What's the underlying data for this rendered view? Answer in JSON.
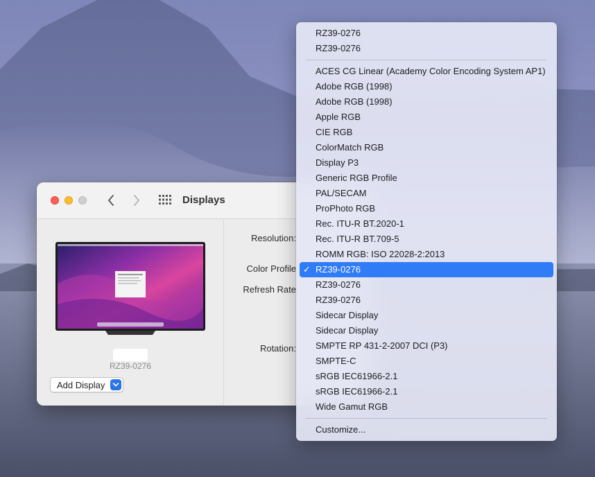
{
  "window": {
    "title": "Displays",
    "display_name": "RZ39-0276",
    "add_display_label": "Add Display",
    "labels": {
      "resolution": "Resolution:",
      "color_profile": "Color Profile",
      "refresh_rate": "Refresh Rate",
      "rotation": "Rotation:"
    }
  },
  "menu": {
    "top_items": [
      "RZ39-0276",
      "RZ39-0276"
    ],
    "items": [
      "ACES CG Linear (Academy Color Encoding System AP1)",
      "Adobe RGB (1998)",
      "Adobe RGB (1998)",
      "Apple RGB",
      "CIE RGB",
      "ColorMatch RGB",
      "Display P3",
      "Generic RGB Profile",
      "PAL/SECAM",
      "ProPhoto RGB",
      "Rec. ITU-R BT.2020-1",
      "Rec. ITU-R BT.709-5",
      "ROMM RGB: ISO 22028-2:2013",
      "RZ39-0276",
      "RZ39-0276",
      "RZ39-0276",
      "Sidecar Display",
      "Sidecar Display",
      "SMPTE RP 431-2-2007 DCI (P3)",
      "SMPTE-C",
      "sRGB IEC61966-2.1",
      "sRGB IEC61966-2.1",
      "Wide Gamut RGB"
    ],
    "selected_index": 13,
    "checkmark": "✓",
    "customize_label": "Customize..."
  },
  "colors": {
    "accent": "#2f7cf6",
    "close": "#fe5f57",
    "minimize": "#febc2e"
  }
}
